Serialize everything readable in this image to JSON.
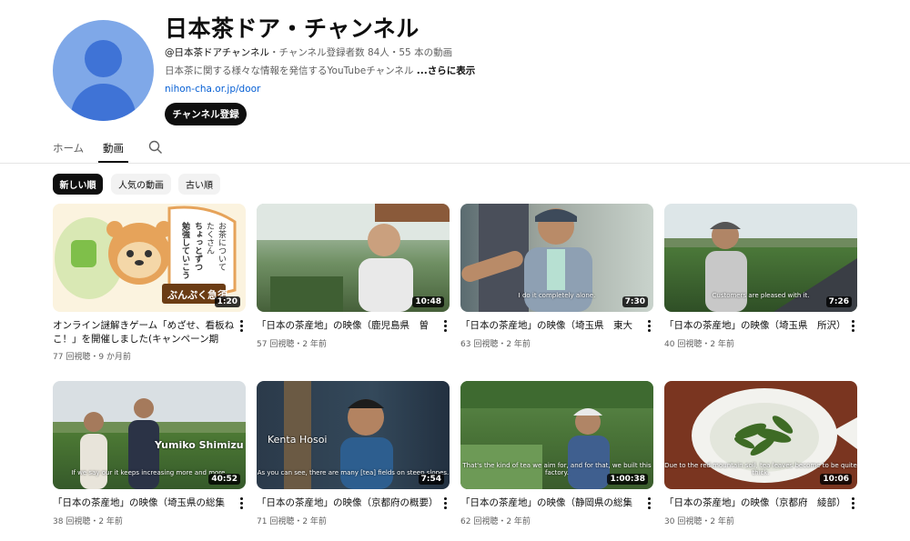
{
  "channel": {
    "title": "日本茶ドア・チャンネル",
    "handle": "@日本茶ドアチャンネル",
    "stats": "・チャンネル登録者数 84人・55 本の動画",
    "description": "日本茶に関する様々な情報を発信するYouTubeチャンネル",
    "more_label": "...さらに表示",
    "link": "nihon-cha.or.jp/door",
    "subscribe_label": "チャンネル登録",
    "avatar_icon": "default-avatar-icon"
  },
  "tabs": [
    {
      "label": "ホーム"
    },
    {
      "label": "動画"
    }
  ],
  "chips": [
    {
      "label": "新しい順"
    },
    {
      "label": "人気の動画"
    },
    {
      "label": "古い順"
    }
  ],
  "videos": [
    {
      "title": "オンライン謎解きゲーム「めざせ、看板ねこ！」を開催しました(キャンペーン期間...",
      "meta": "77 回視聴・9 か月前",
      "duration": "1:20",
      "thumb_label": "ぶんぷく急須"
    },
    {
      "title": "「日本の茶産地」の映像（鹿児島県　曽於）",
      "meta": "57 回視聴・2 年前",
      "duration": "10:48"
    },
    {
      "title": "「日本の茶産地」の映像（埼玉県　東大和）",
      "meta": "63 回視聴・2 年前",
      "duration": "7:30",
      "subtitle": "I do it completely alone."
    },
    {
      "title": "「日本の茶産地」の映像（埼玉県　所沢）",
      "meta": "40 回視聴・2 年前",
      "duration": "7:26",
      "subtitle": "Customers are pleased with it."
    },
    {
      "title": "「日本の茶産地」の映像（埼玉県の総集編）",
      "meta": "38 回視聴・2 年前",
      "duration": "40:52",
      "name_overlay": "Yumiko Shimizu",
      "subtitle": "If we say our it keeps increasing more and more."
    },
    {
      "title": "「日本の茶産地」の映像（京都府の概要）",
      "meta": "71 回視聴・2 年前",
      "duration": "7:54",
      "name_overlay": "Kenta Hosoi",
      "subtitle": "As you can see, there are many [tea] fields on steep slopes."
    },
    {
      "title": "「日本の茶産地」の映像（静岡県の総集編）",
      "meta": "62 回視聴・2 年前",
      "duration": "1:00:38",
      "subtitle": "That's the kind of tea we aim for, and for that, we built this factory."
    },
    {
      "title": "「日本の茶産地」の映像（京都府　綾部）",
      "meta": "30 回視聴・2 年前",
      "duration": "10:06",
      "subtitle": "Due to the red mountain soil, tea leaves become to be quite thick."
    }
  ]
}
